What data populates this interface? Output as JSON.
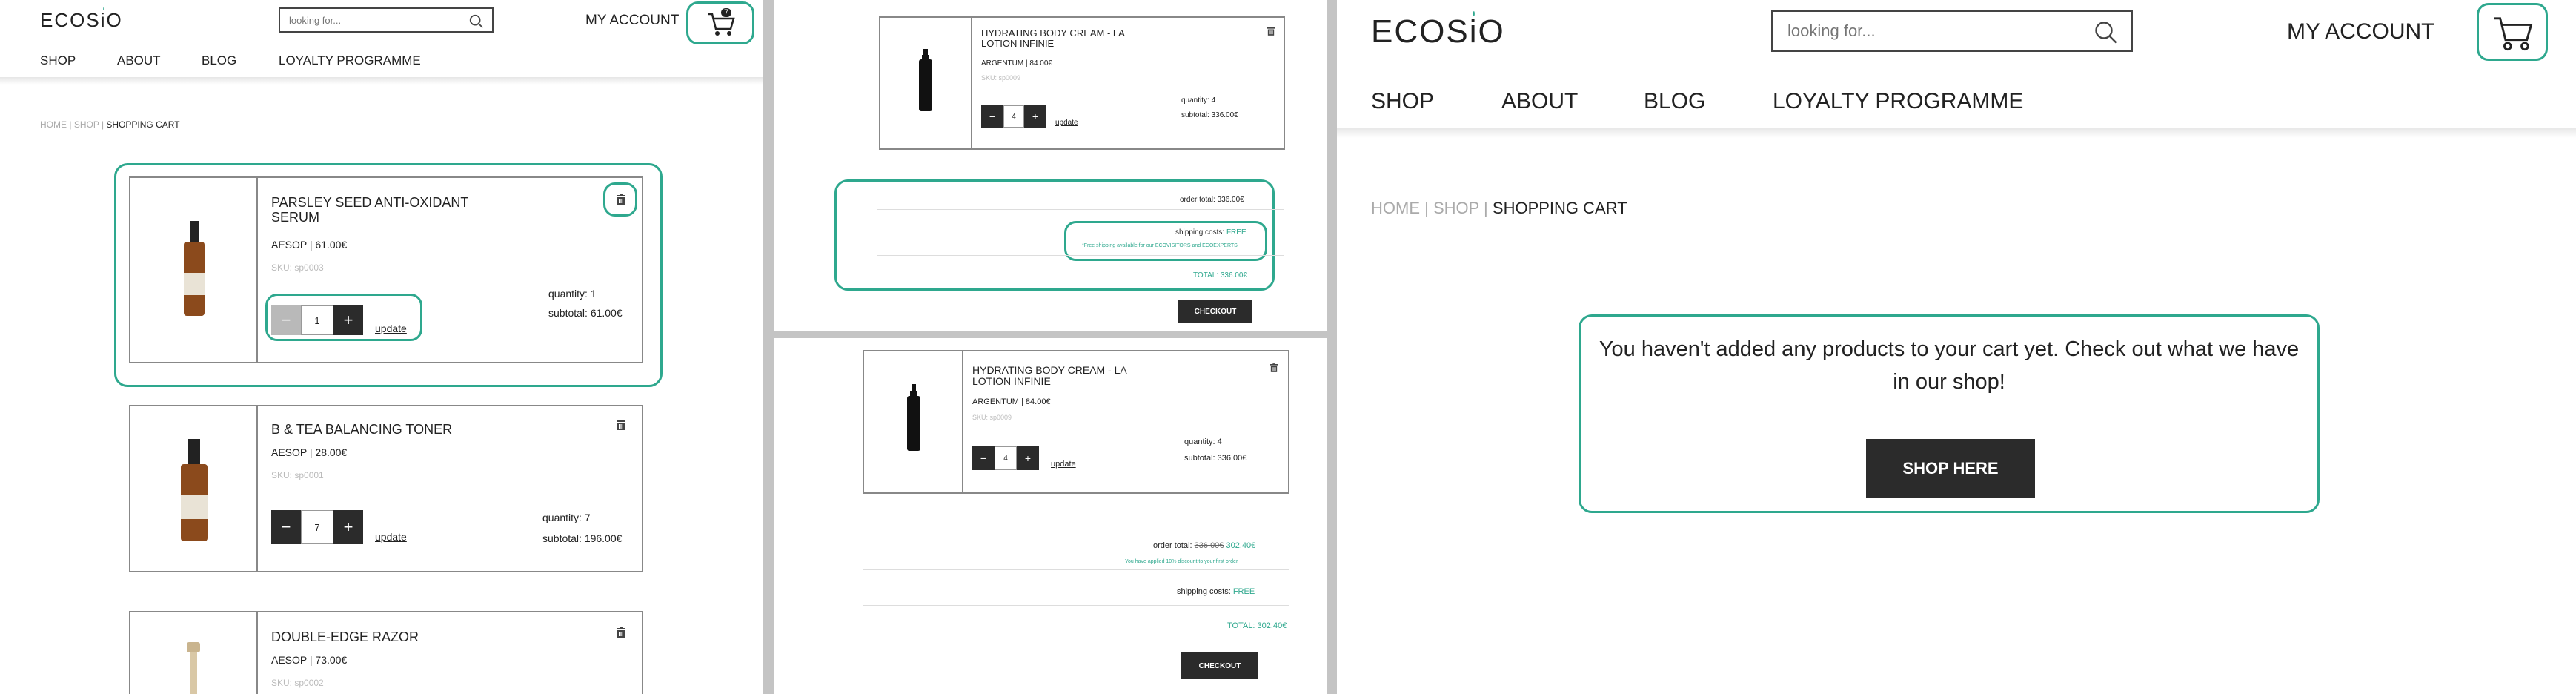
{
  "brand": {
    "logo": "ECOSiO",
    "logo_pre": "ECOS",
    "logo_i": "i",
    "logo_post": "O",
    "accent": "#2ea88e"
  },
  "header": {
    "search_placeholder": "looking for...",
    "account": "MY ACCOUNT",
    "cart_count": "7",
    "nav": [
      "SHOP",
      "ABOUT",
      "BLOG",
      "LOYALTY PROGRAMME"
    ]
  },
  "breadcrumb": {
    "home": "HOME",
    "shop": "SHOP",
    "current": "SHOPPING CART",
    "sep": "|"
  },
  "panel1": {
    "items": [
      {
        "name": "PARSLEY SEED ANTI-OXIDANT SERUM",
        "brand": "AESOP | 61.00€",
        "sku": "SKU: sp0003",
        "qty": "1",
        "quantity": "quantity: 1",
        "subtotal": "subtotal: 61.00€",
        "update": "update"
      },
      {
        "name": "B & TEA BALANCING TONER",
        "brand": "AESOP | 28.00€",
        "sku": "SKU: sp0001",
        "qty": "7",
        "quantity": "quantity: 7",
        "subtotal": "subtotal: 196.00€",
        "update": "update"
      },
      {
        "name": "DOUBLE-EDGE RAZOR",
        "brand": "AESOP | 73.00€",
        "sku": "SKU: sp0002"
      }
    ]
  },
  "panel2": {
    "top_item": {
      "name": "HYDRATING BODY CREAM - LA LOTION INFINIE",
      "brand": "ARGENTUM | 84.00€",
      "sku": "SKU: sp0009",
      "qty": "4",
      "quantity": "quantity: 4",
      "subtotal": "subtotal: 336.00€",
      "update": "update"
    },
    "top_totals": {
      "order_total": "order total: 336.00€",
      "shipping_label": "shipping costs:",
      "shipping_value": "FREE",
      "shipping_note": "*Free shipping available for our ECOVISITORS and ECOEXPERTS",
      "total": "TOTAL: 336.00€",
      "checkout": "CHECKOUT"
    },
    "bottom_item": {
      "name": "HYDRATING BODY CREAM - LA LOTION INFINIE",
      "brand": "ARGENTUM | 84.00€",
      "sku": "SKU: sp0009",
      "qty": "4",
      "quantity": "quantity: 4",
      "subtotal": "subtotal: 336.00€",
      "update": "update"
    },
    "bottom_totals": {
      "order_total_label": "order total:",
      "old_price": "336.00€",
      "new_price": "302.40€",
      "discount_note": "You have applied 10% discount to your first order",
      "shipping_label": "shipping costs:",
      "shipping_value": "FREE",
      "total": "TOTAL: 302.40€",
      "checkout": "CHECKOUT"
    }
  },
  "panel3": {
    "empty_message": "You haven't added any products to your cart yet. Check out what we have in our shop!",
    "shop_here": "SHOP HERE"
  },
  "icons": [
    "search-icon",
    "cart-icon",
    "trash-icon",
    "minus-icon",
    "plus-icon"
  ]
}
